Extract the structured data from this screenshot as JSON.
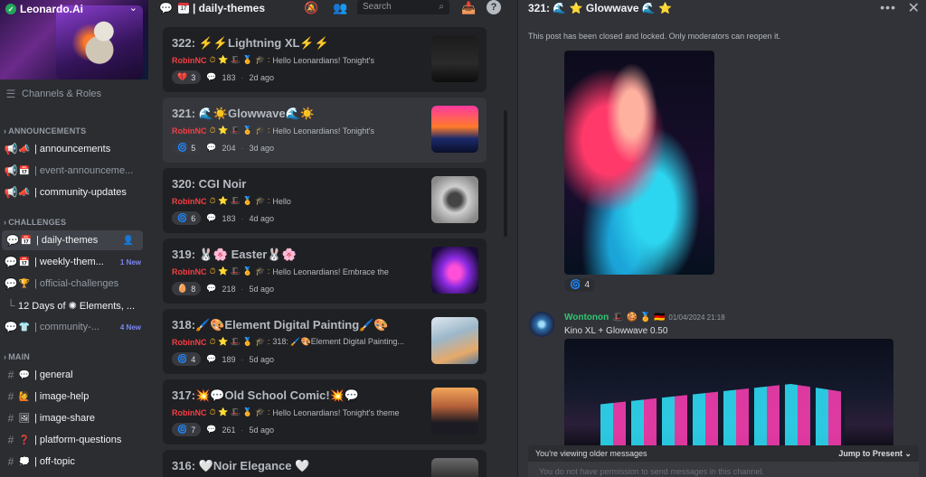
{
  "server": {
    "name": "Leonardo.Ai"
  },
  "sidebar": {
    "channels_roles": "Channels & Roles",
    "categories": {
      "announcements": "ANNOUNCEMENTS",
      "challenges": "CHALLENGES",
      "main": "MAIN"
    },
    "announcements": [
      {
        "label": "| announcements"
      },
      {
        "label": "| event-announceme..."
      },
      {
        "label": "| community-updates"
      }
    ],
    "challenges": [
      {
        "label": "| daily-themes"
      },
      {
        "label": "| weekly-them...",
        "badge": "1 New"
      },
      {
        "label": "| official-challenges"
      },
      {
        "label": "12 Days of ✺ Elements, ..."
      },
      {
        "label": "| community-...",
        "badge": "4 New"
      }
    ],
    "main": [
      {
        "label": "| general"
      },
      {
        "label": "| image-help"
      },
      {
        "label": "| image-share"
      },
      {
        "label": "| platform-questions"
      },
      {
        "label": "| off-topic"
      }
    ]
  },
  "forum": {
    "title": "| daily-themes",
    "search_placeholder": "Search",
    "posts": [
      {
        "title": "322: ⚡⚡Lightning XL⚡⚡",
        "author": "RobinNC",
        "preview": "Hello Leonardians!    Tonight's",
        "reaction": "3",
        "replies": "183",
        "age": "2d ago"
      },
      {
        "title": "321: 🌊☀️Glowwave🌊☀️",
        "author": "RobinNC",
        "preview": "Hello Leonardians!    Tonight's",
        "reaction": "5",
        "replies": "204",
        "age": "3d ago"
      },
      {
        "title": "320:    CGI Noir",
        "author": "RobinNC",
        "preview": "Hello",
        "reaction": "6",
        "replies": "183",
        "age": "4d ago"
      },
      {
        "title": "319: 🐰🌸 Easter🐰🌸",
        "author": "RobinNC",
        "preview": "Hello Leonardians!    Embrace the",
        "reaction": "8",
        "replies": "218",
        "age": "5d ago"
      },
      {
        "title": "318:🖌️🎨Element Digital Painting🖌️🎨",
        "author": "RobinNC",
        "preview": "318: 🖌️🎨Element Digital Painting...",
        "reaction": "4",
        "replies": "189",
        "age": "5d ago"
      },
      {
        "title": "317:💥💬Old School Comic!💥💬",
        "author": "RobinNC",
        "preview": "Hello Leonardians!    Tonight's theme",
        "reaction": "7",
        "replies": "261",
        "age": "5d ago"
      },
      {
        "title": "316:   🤍Noir Elegance    🤍"
      }
    ]
  },
  "thread": {
    "title": "321: 🌊 ⭐ Glowwave 🌊 ⭐",
    "locked_note": "This post has been closed and locked. Only moderators can reopen it.",
    "reaction_count": "4",
    "message": {
      "author": "Wontonon",
      "timestamp": "01/04/2024 21:18",
      "text": "Kino XL + Glowwave 0.50"
    },
    "older_notice": "You're viewing older messages",
    "jump_label": "Jump to Present",
    "no_permission": "You do not have permission to send messages in this channel."
  },
  "colors": {
    "author_red": "#f23f43",
    "author_green": "#2dc770",
    "accent": "#7b86f2"
  }
}
